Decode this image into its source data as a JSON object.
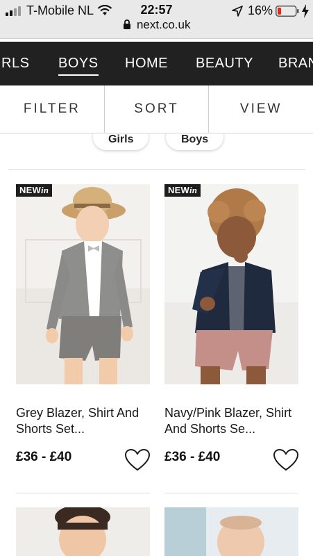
{
  "status_bar": {
    "carrier": "T-Mobile NL",
    "time": "22:57",
    "battery": "16%",
    "url": "next.co.uk"
  },
  "nav": {
    "items": [
      {
        "label": "IRLS"
      },
      {
        "label": "BOYS"
      },
      {
        "label": "HOME"
      },
      {
        "label": "BEAUTY"
      },
      {
        "label": "BRAN"
      }
    ],
    "active": "BOYS"
  },
  "filter_bar": {
    "filter": "FILTER",
    "sort": "SORT",
    "view": "VIEW"
  },
  "chips": [
    "Girls",
    "Boys"
  ],
  "products": [
    {
      "badge_prefix": "NEW",
      "badge_suffix": "in",
      "name": "Grey Blazer, Shirt And Shorts Set...",
      "price": "£36 - £40"
    },
    {
      "badge_prefix": "NEW",
      "badge_suffix": "in",
      "name": "Navy/Pink Blazer, Shirt And Shorts Se...",
      "price": "£36 - £40"
    }
  ],
  "colors": {
    "nav_bg": "#212121",
    "status_bg": "#e9e9e9",
    "battery_low": "#e0291c"
  }
}
